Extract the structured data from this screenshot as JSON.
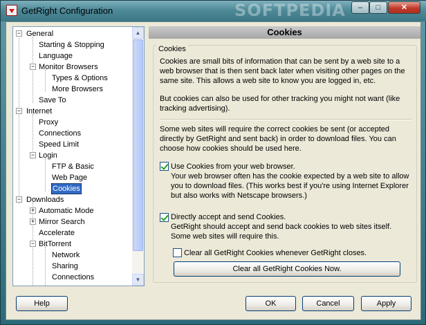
{
  "window": {
    "title": "GetRight Configuration",
    "watermark": "SOFTPEDIA"
  },
  "titlebar_buttons": {
    "minimize": "–",
    "maximize": "□",
    "close": "✕"
  },
  "tree": {
    "items": [
      {
        "label": "General",
        "expander": "−"
      },
      {
        "label": "Starting & Stopping"
      },
      {
        "label": "Language"
      },
      {
        "label": "Monitor Browsers",
        "expander": "−"
      },
      {
        "label": "Types & Options"
      },
      {
        "label": "More Browsers"
      },
      {
        "label": "Save To"
      },
      {
        "label": "Internet",
        "expander": "−"
      },
      {
        "label": "Proxy"
      },
      {
        "label": "Connections"
      },
      {
        "label": "Speed Limit"
      },
      {
        "label": "Login",
        "expander": "−"
      },
      {
        "label": "FTP & Basic"
      },
      {
        "label": "Web Page"
      },
      {
        "label": "Cookies",
        "selected": true
      },
      {
        "label": "Downloads",
        "expander": "−"
      },
      {
        "label": "Automatic Mode",
        "expander": "+"
      },
      {
        "label": "Mirror Search",
        "expander": "+"
      },
      {
        "label": "Accelerate"
      },
      {
        "label": "BitTorrent",
        "expander": "−"
      },
      {
        "label": "Network"
      },
      {
        "label": "Sharing"
      },
      {
        "label": "Connections"
      }
    ]
  },
  "panel": {
    "header": "Cookies",
    "group_title": "Cookies",
    "para1": "Cookies are small bits of information that can be sent by a web site to a web browser that is then sent back later when visiting other pages on the same site.  This allows a web site to know you are logged in, etc.",
    "para2": "But cookies can also be used for other tracking you might not want (like tracking advertising).",
    "para3": "Some web sites will require the correct cookies be sent (or accepted directly by GetRight and sent back) in order to download files.  You can choose how cookies should be used here.",
    "opt1_label": "Use Cookies from your web browser.",
    "opt1_desc": "Your web browser often has the cookie expected by a web site to allow you to download files.  (This works best if you're using Internet Explorer but also works with Netscape browsers.)",
    "opt2_label": "Directly accept and send Cookies.",
    "opt2_desc": "GetRight should accept and send back cookies to web sites itself.  Some web sites will require this.",
    "opt3_label": "Clear all GetRight Cookies whenever GetRight closes.",
    "clear_button": "Clear all GetRight Cookies Now."
  },
  "buttons": {
    "help": "Help",
    "ok": "OK",
    "cancel": "Cancel",
    "apply": "Apply"
  }
}
